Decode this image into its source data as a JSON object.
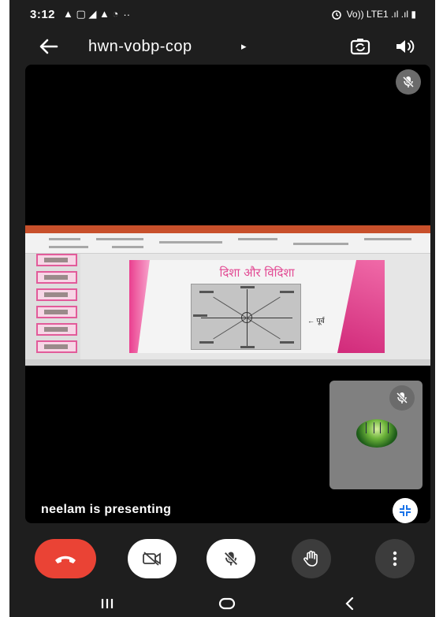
{
  "status_bar": {
    "time": "3:12",
    "left_glyphs": "▲ ▢ ◢ ▲ ◔",
    "dots": "··",
    "right_text": "Vo)) LTE1 .ıl .ıl ▮"
  },
  "app_bar": {
    "meeting_code": "hwn-vobp-cop",
    "caret": "▸"
  },
  "presentation": {
    "slide_title": "दिशा और विदिशा",
    "slide_mark": "← पूर्व"
  },
  "presenting_text": "neelam is presenting",
  "colors": {
    "end_call": "#ea4335",
    "accent_pink": "#e24a93",
    "ribbon": "#c8502b",
    "background": "#1e1e1e"
  },
  "icons": {
    "back": "arrow-left-icon",
    "flip_camera": "camera-flip-icon",
    "speaker": "speaker-icon",
    "mic_off": "mic-off-icon",
    "end_call": "phone-hangup-icon",
    "camera_off": "video-off-icon",
    "raise_hand": "hand-icon",
    "more": "more-vertical-icon",
    "fullscreen": "fullscreen-exit-icon"
  }
}
